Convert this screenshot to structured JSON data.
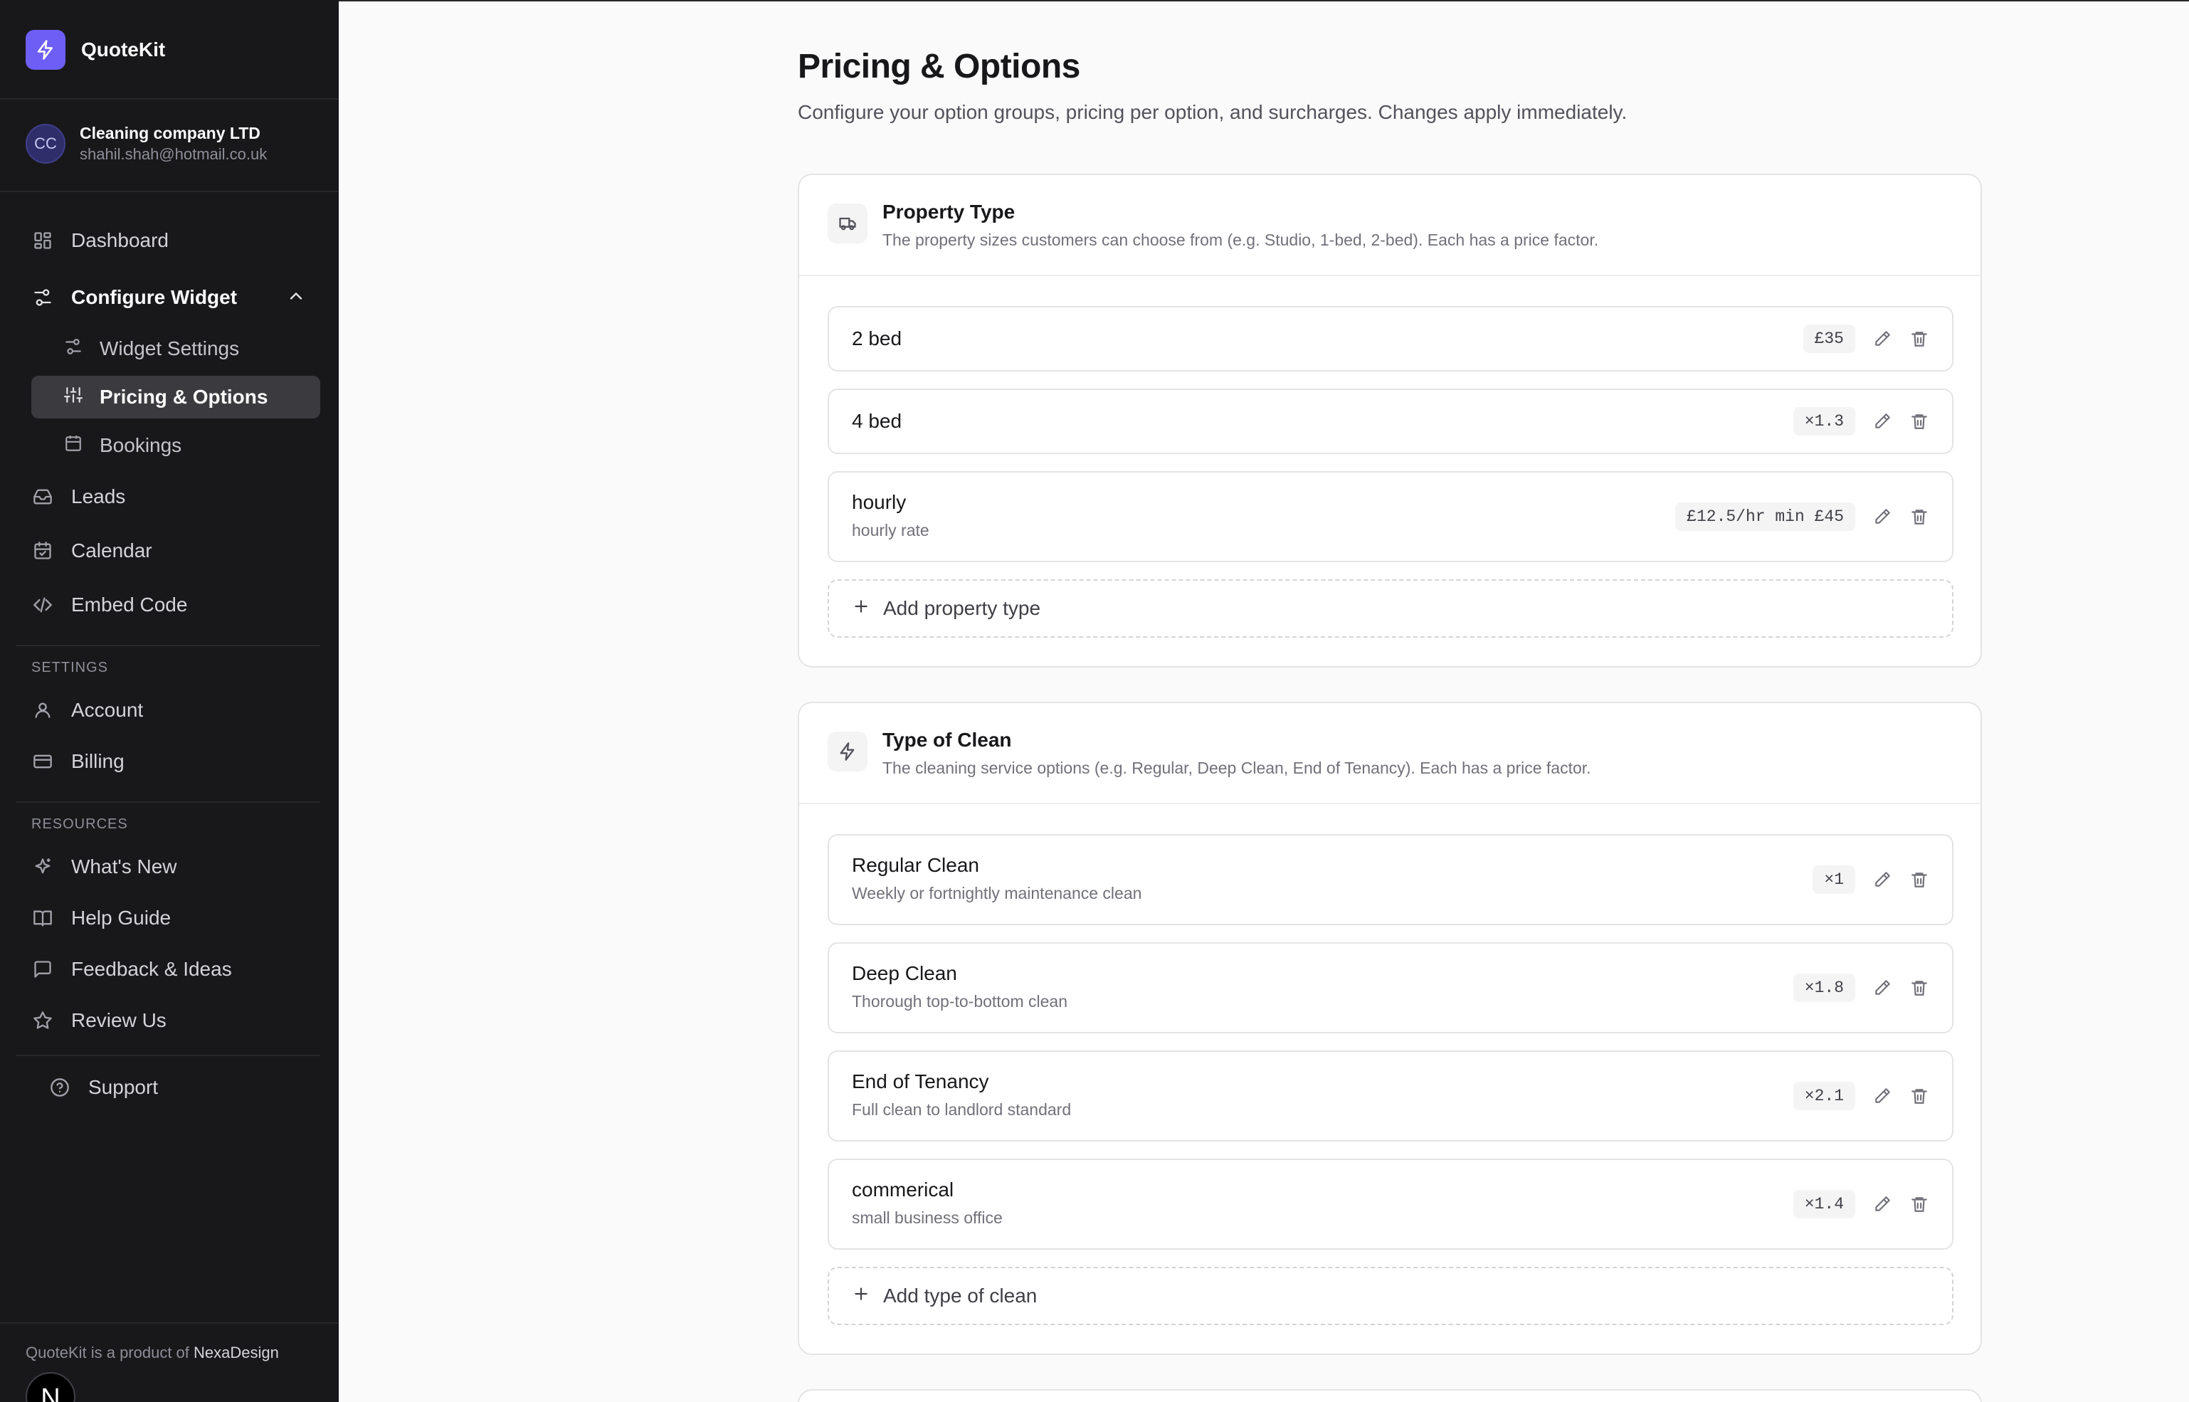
{
  "app": {
    "name": "QuoteKit"
  },
  "account": {
    "initials": "CC",
    "company": "Cleaning company LTD",
    "email": "shahil.shah@hotmail.co.uk"
  },
  "nav": {
    "dashboard": "Dashboard",
    "configure_widget": "Configure Widget",
    "widget_settings": "Widget Settings",
    "pricing_options": "Pricing & Options",
    "bookings": "Bookings",
    "leads": "Leads",
    "calendar": "Calendar",
    "embed_code": "Embed Code",
    "settings_label": "SETTINGS",
    "account": "Account",
    "billing": "Billing",
    "resources_label": "RESOURCES",
    "whats_new": "What's New",
    "help_guide": "Help Guide",
    "feedback": "Feedback & Ideas",
    "review_us": "Review Us",
    "support": "Support"
  },
  "footer": {
    "prefix": "QuoteKit is a product of",
    "brand": "NexaDesign",
    "badge": "N"
  },
  "page": {
    "title": "Pricing & Options",
    "subtitle": "Configure your option groups, pricing per option, and surcharges. Changes apply immediately."
  },
  "groups": [
    {
      "title": "Property Type",
      "description": "The property sizes customers can choose from (e.g. Studio, 1-bed, 2-bed). Each has a price factor.",
      "add_label": "Add property type",
      "options": [
        {
          "name": "2 bed",
          "sub": "",
          "price": "£35"
        },
        {
          "name": "4 bed",
          "sub": "",
          "price": "×1.3"
        },
        {
          "name": "hourly",
          "sub": "hourly rate",
          "price": "£12.5/hr min £45"
        }
      ]
    },
    {
      "title": "Type of Clean",
      "description": "The cleaning service options (e.g. Regular, Deep Clean, End of Tenancy). Each has a price factor.",
      "add_label": "Add type of clean",
      "options": [
        {
          "name": "Regular Clean",
          "sub": "Weekly or fortnightly maintenance clean",
          "price": "×1"
        },
        {
          "name": "Deep Clean",
          "sub": "Thorough top-to-bottom clean",
          "price": "×1.8"
        },
        {
          "name": "End of Tenancy",
          "sub": "Full clean to landlord standard",
          "price": "×2.1"
        },
        {
          "name": "commerical",
          "sub": "small business office",
          "price": "×1.4"
        }
      ]
    }
  ],
  "colors": {
    "accent": "#6d5ef6",
    "sidebar_bg": "#18181b",
    "page_bg": "#fafafa"
  }
}
